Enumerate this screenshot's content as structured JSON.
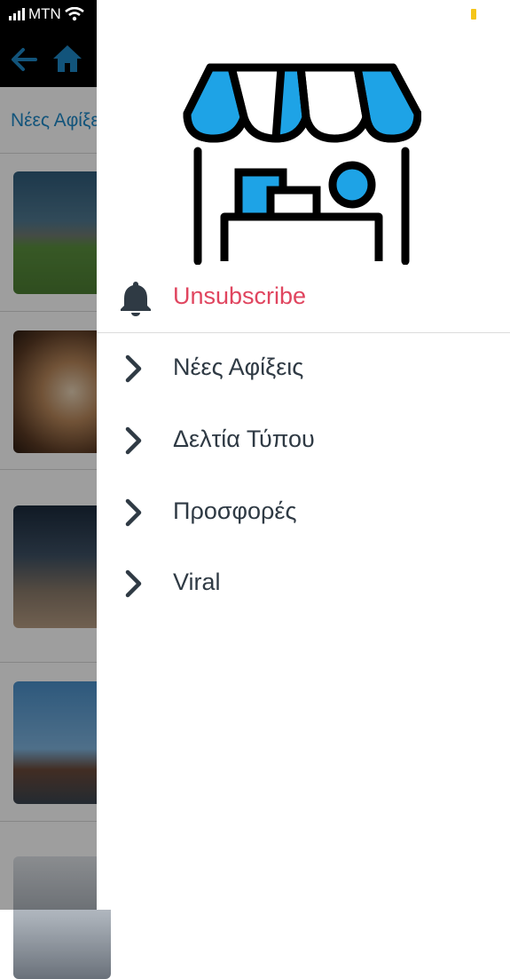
{
  "status_bar": {
    "carrier": "MTN"
  },
  "background_page": {
    "title": "Νέες Αφίξεις"
  },
  "drawer": {
    "unsubscribe_label": "Unsubscribe",
    "menu_items": [
      {
        "label": "Νέες Αφίξεις",
        "icon": "chevron-right-icon"
      },
      {
        "label": "Δελτία Τύπου",
        "icon": "chevron-right-icon"
      },
      {
        "label": "Προσφορές",
        "icon": "chevron-right-icon"
      },
      {
        "label": "Viral",
        "icon": "chevron-right-icon"
      }
    ]
  },
  "colors": {
    "accent_blue": "#1e88c7",
    "logo_blue": "#1ea3e6",
    "unsubscribe_red": "#e0455f",
    "menu_text": "#2f3a44"
  }
}
